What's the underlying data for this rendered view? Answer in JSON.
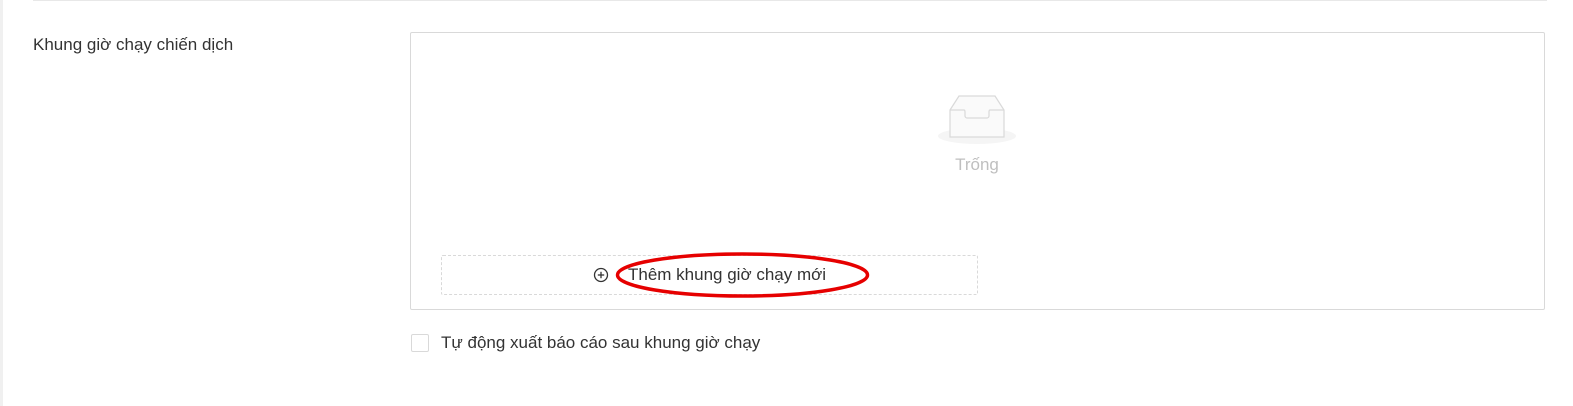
{
  "schedule_section": {
    "label": "Khung giờ chạy chiến dịch",
    "empty_state": {
      "icon": "empty-inbox-icon",
      "text": "Trống"
    },
    "add_button": {
      "icon": "plus-circle-icon",
      "label": "Thêm khung giờ chạy mới",
      "highlight_color": "#e60000"
    }
  },
  "auto_report": {
    "checked": false,
    "label": "Tự động xuất báo cáo sau khung giờ chạy"
  }
}
